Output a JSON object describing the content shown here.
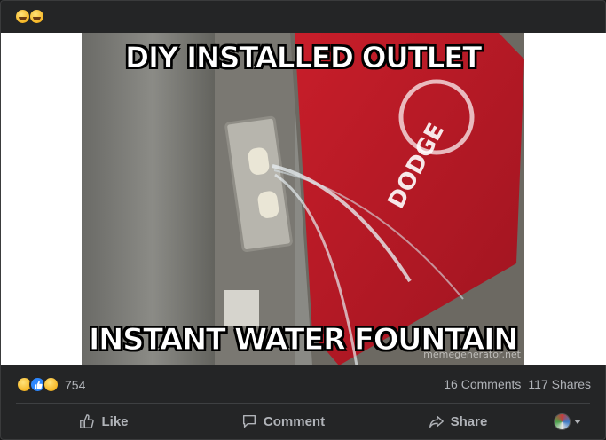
{
  "post": {
    "caption_emojis": [
      "laughing-emoji",
      "sweat-smile-emoji"
    ],
    "meme": {
      "top_text": "DIY INSTALLED OUTLET",
      "bottom_text": "INSTANT WATER FOUNTAIN",
      "watermark": "memegenerator.net",
      "sign_text": "DODGE"
    },
    "reactions": {
      "icons": [
        "haha-icon",
        "like-icon",
        "wow-icon"
      ],
      "count": "754"
    },
    "comments_label": "16 Comments",
    "shares_label": "117 Shares",
    "actions": {
      "like": "Like",
      "comment": "Comment",
      "share": "Share"
    }
  }
}
